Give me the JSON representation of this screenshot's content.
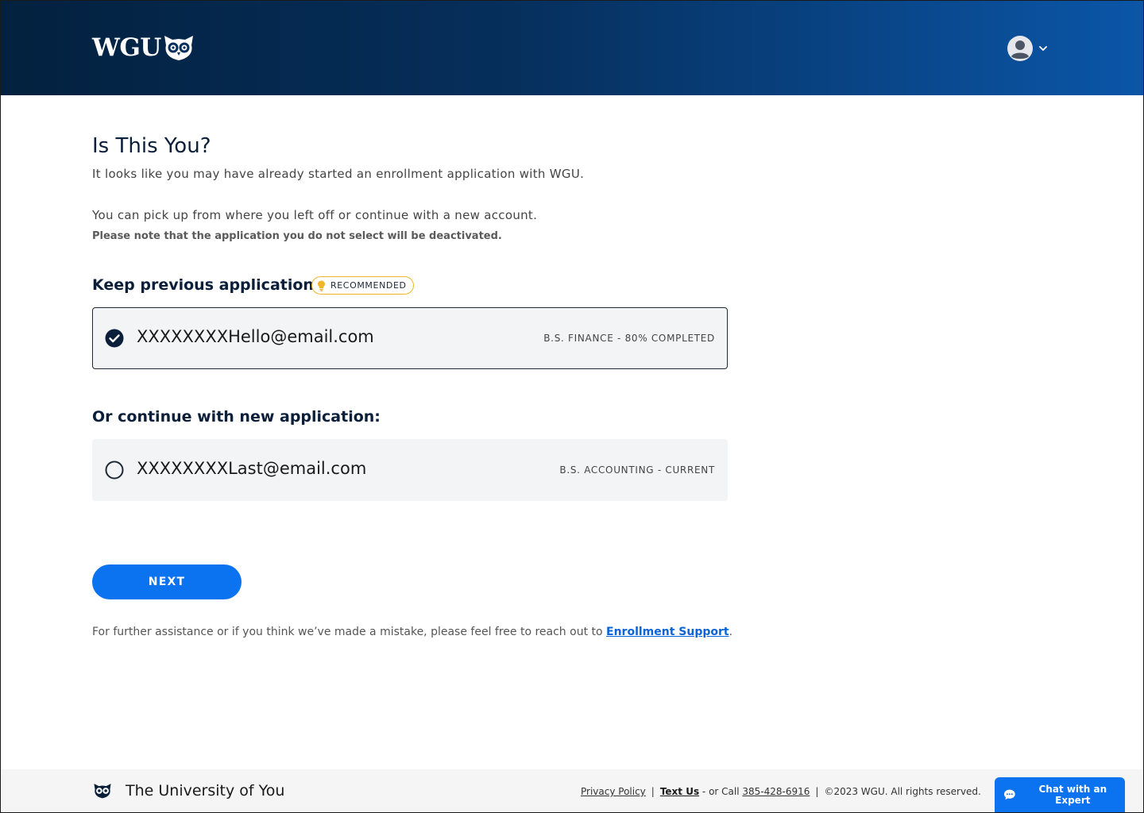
{
  "header": {
    "logo_text": "WGU"
  },
  "main": {
    "title": "Is This You?",
    "intro_line1": "It looks like you may have already started an enrollment application with WGU.",
    "intro_line2": "You can pick up from where you left off or continue with a new account.",
    "note": "Please note that the application you do not select will be deactivated.",
    "keep_title": "Keep previous application:",
    "badge": "RECOMMENDED",
    "new_title": "Or continue with new application:",
    "options": [
      {
        "email": "XXXXXXXXHello@email.com",
        "program": "B.S. FINANCE - 80% COMPLETED",
        "selected": true
      },
      {
        "email": "XXXXXXXXLast@email.com",
        "program": "B.S. ACCOUNTING - CURRENT",
        "selected": false
      }
    ],
    "next_label": "NEXT",
    "assist_text": "For further assistance or if you think we’ve made a mistake, please feel free to reach out to ",
    "assist_link": "Enrollment Support",
    "assist_end": "."
  },
  "footer": {
    "tagline": "The University of You",
    "privacy": "Privacy Policy",
    "sep": "|",
    "text_us": "Text Us",
    "call_prefix": " - or Call ",
    "phone": "385-428-6916",
    "copyright": "©2023 WGU. All rights reserved.",
    "chat_label": "Chat with an Expert"
  },
  "colors": {
    "header_start": "#03213f",
    "header_end": "#0b56a8",
    "primary": "#0b72f0",
    "badge_border": "#f1b52b",
    "link": "#0b63d8"
  },
  "icons": {
    "logo": "owl-icon",
    "avatar": "user-avatar-icon",
    "chevron": "chevron-down-icon",
    "badge": "lightbulb-icon",
    "selected": "check-circle-icon",
    "unselected": "radio-empty-icon",
    "chat": "chat-bubble-icon"
  }
}
